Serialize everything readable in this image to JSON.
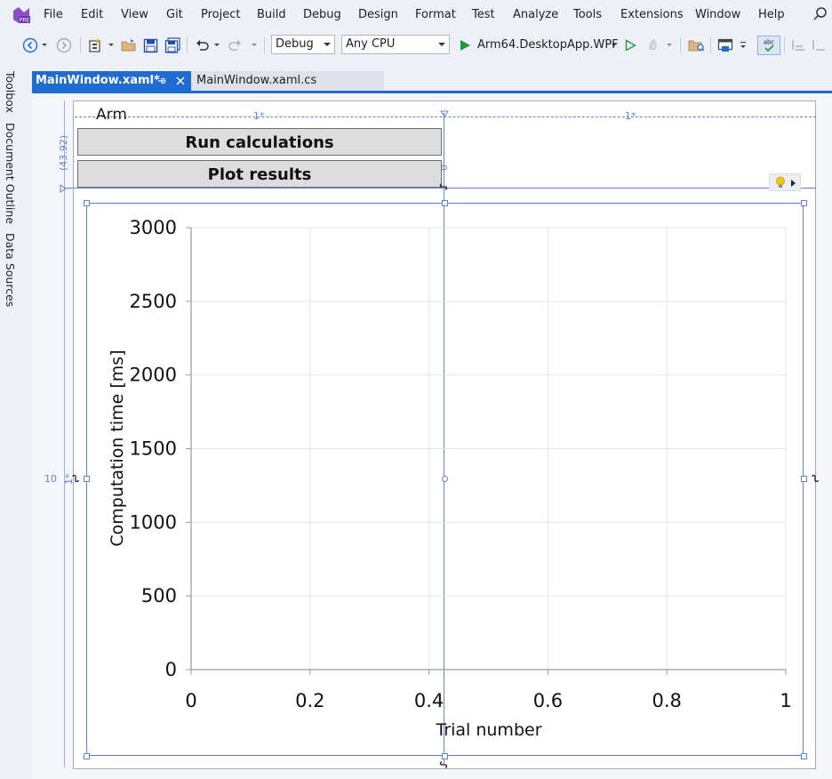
{
  "menu": {
    "items": [
      "File",
      "Edit",
      "View",
      "Git",
      "Project",
      "Build",
      "Debug",
      "Design",
      "Format",
      "Test",
      "Analyze",
      "Tools",
      "Extensions",
      "Window",
      "Help"
    ]
  },
  "toolbar": {
    "config": "Debug",
    "platform": "Any CPU",
    "run_target": "Arm64.DesktopApp.WPF"
  },
  "sidebar": {
    "tabs": [
      "Toolbox",
      "Document Outline",
      "Data Sources"
    ]
  },
  "tabs": {
    "active": "MainWindow.xaml*",
    "inactive": "MainWindow.xaml.cs"
  },
  "designer": {
    "window_title": "Arm",
    "col1_size": "1*",
    "col2_size": "1*",
    "row1_size": "(43.92)",
    "row2_size": "1*",
    "left_margin": "10",
    "button_top_margin": "0",
    "run_button": "Run calculations",
    "plot_button": "Plot results"
  },
  "colors": {
    "accent": "#1f6bcf",
    "grid_adorner": "#5b86d8",
    "run_green": "#1e9c3a"
  },
  "chart_data": {
    "type": "line",
    "title": "",
    "xlabel": "Trial number",
    "ylabel": "Computation time [ms]",
    "xlim": [
      0,
      1
    ],
    "ylim": [
      0,
      3000
    ],
    "xticks": [
      0,
      0.2,
      0.4,
      0.6,
      0.8,
      1
    ],
    "yticks": [
      0,
      500,
      1000,
      1500,
      2000,
      2500,
      3000
    ],
    "xtick_labels": [
      "0",
      "0.2",
      "0.4",
      "0.6",
      "0.8",
      "1"
    ],
    "ytick_labels": [
      "0",
      "500",
      "1000",
      "1500",
      "2000",
      "2500",
      "3000"
    ],
    "grid": true,
    "series": []
  }
}
